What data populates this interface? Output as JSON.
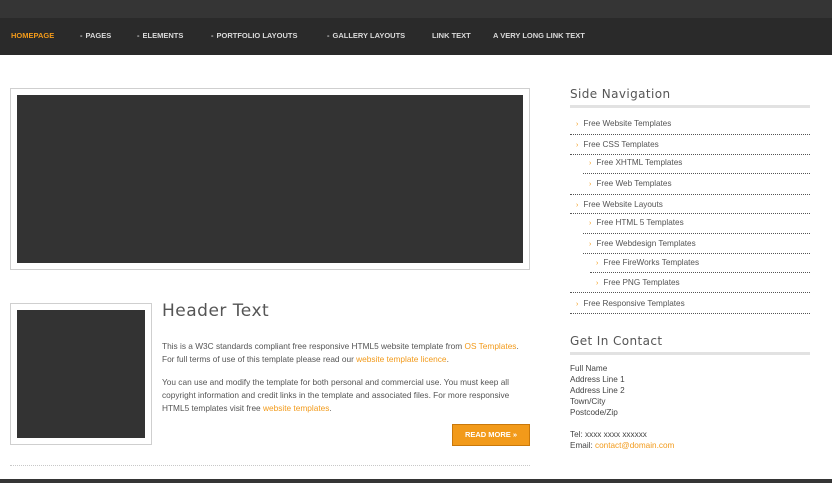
{
  "nav": {
    "items": [
      {
        "label": "HOMEPAGE",
        "dash": ""
      },
      {
        "label": "PAGES",
        "dash": "-"
      },
      {
        "label": "ELEMENTS",
        "dash": "-"
      },
      {
        "label": "PORTFOLIO LAYOUTS",
        "dash": "-"
      },
      {
        "label": "GALLERY LAYOUTS",
        "dash": "-"
      },
      {
        "label": "LINK TEXT",
        "dash": ""
      },
      {
        "label": "A VERY LONG LINK TEXT",
        "dash": ""
      }
    ],
    "active_color": "#f29a1a"
  },
  "article": {
    "title": "Header Text",
    "p1_a": "This is a W3C standards compliant free responsive HTML5 website template from ",
    "p1_link1": "OS Templates",
    "p1_b": ". For full terms of use of this template please read our ",
    "p1_link2": "website template licence",
    "p1_c": ".",
    "p2_a": "You can use and modify the template for both personal and commercial use. You must keep all copyright information and credit links in the template and associated files. For more responsive HTML5 templates visit free ",
    "p2_link": "website templates",
    "p2_b": ".",
    "read_more": "READ MORE »"
  },
  "sidebar": {
    "nav_title": "Side Navigation",
    "items": [
      {
        "label": "Free Website Templates"
      },
      {
        "label": "Free CSS Templates"
      },
      {
        "label": "Free XHTML Templates"
      },
      {
        "label": "Free Web Templates"
      },
      {
        "label": "Free Website Layouts"
      },
      {
        "label": "Free HTML 5 Templates"
      },
      {
        "label": "Free Webdesign Templates"
      },
      {
        "label": "Free FireWorks Templates"
      },
      {
        "label": "Free PNG Templates"
      },
      {
        "label": "Free Responsive Templates"
      }
    ],
    "arrow": "›",
    "contact_title": "Get In Contact",
    "contact": {
      "name": "Full Name",
      "address1": "Address Line 1",
      "address2": "Address Line 2",
      "town": "Town/City",
      "postcode": "Postcode/Zip",
      "tel": "Tel: xxxx xxxx xxxxxx",
      "email_label": "Email: ",
      "email": "contact@domain.com"
    }
  }
}
